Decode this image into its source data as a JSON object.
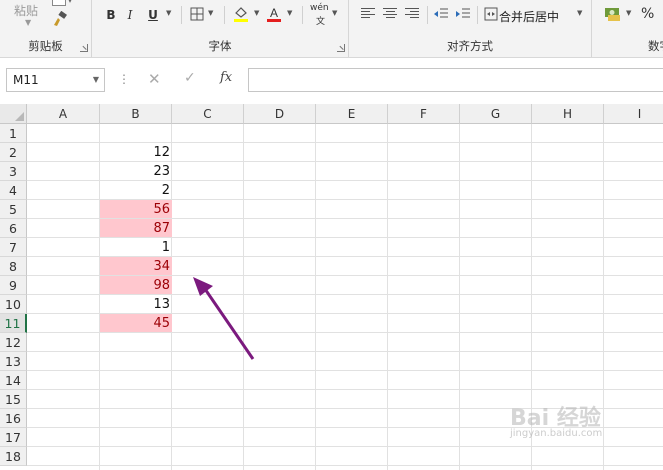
{
  "ribbon": {
    "clipboard": {
      "paste_label": "粘贴",
      "group_label": "剪贴板"
    },
    "font": {
      "bold": "B",
      "italic": "I",
      "underline": "U",
      "phonetic_top": "wén",
      "phonetic_bottom": "文",
      "group_label": "字体"
    },
    "alignment": {
      "merge_label": "合并后居中",
      "group_label": "对齐方式"
    },
    "number": {
      "percent": "%",
      "group_label": "数字"
    }
  },
  "formula_bar": {
    "name_box": "M11",
    "dots": "⋮",
    "cancel": "✕",
    "enter": "✓",
    "fx": "fx",
    "formula": ""
  },
  "sheet": {
    "columns": [
      "A",
      "B",
      "C",
      "D",
      "E",
      "F",
      "G",
      "H",
      "I"
    ],
    "rows": [
      "1",
      "2",
      "3",
      "4",
      "5",
      "6",
      "7",
      "8",
      "9",
      "10",
      "11",
      "12",
      "13",
      "14",
      "15",
      "16",
      "17",
      "18"
    ],
    "active_row": "11",
    "highlight_fill": "#ffc7ce",
    "highlight_text": "#9c0006",
    "b_values": [
      {
        "row": 2,
        "value": "12",
        "highlight": false
      },
      {
        "row": 3,
        "value": "23",
        "highlight": false
      },
      {
        "row": 4,
        "value": "2",
        "highlight": false
      },
      {
        "row": 5,
        "value": "56",
        "highlight": true
      },
      {
        "row": 6,
        "value": "87",
        "highlight": true
      },
      {
        "row": 7,
        "value": "1",
        "highlight": false
      },
      {
        "row": 8,
        "value": "34",
        "highlight": true
      },
      {
        "row": 9,
        "value": "98",
        "highlight": true
      },
      {
        "row": 10,
        "value": "13",
        "highlight": false
      },
      {
        "row": 11,
        "value": "45",
        "highlight": true
      }
    ]
  },
  "watermark": {
    "main": "Bai 经验",
    "sub": "jingyan.baidu.com"
  }
}
